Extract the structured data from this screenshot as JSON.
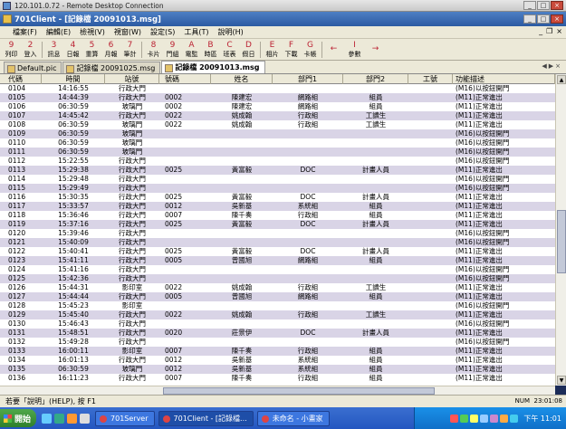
{
  "rd_title": "120.101.0.72 - Remote Desktop Connection",
  "app_title": "701Client - [記錄檔 20091013.msg]",
  "menu": [
    "檔案(F)",
    "編輯(E)",
    "檢視(V)",
    "視窗(W)",
    "設定(S)",
    "工具(T)",
    "說明(H)"
  ],
  "toolbar": [
    {
      "glyph": "9",
      "label": "列印"
    },
    {
      "glyph": "2",
      "label": "登入"
    },
    {
      "glyph": "3",
      "label": "訊息"
    },
    {
      "glyph": "4",
      "label": "日報"
    },
    {
      "glyph": "5",
      "label": "重算"
    },
    {
      "glyph": "6",
      "label": "月報"
    },
    {
      "glyph": "7",
      "label": "筆計"
    },
    {
      "glyph": "8",
      "label": "卡片"
    },
    {
      "glyph": "9",
      "label": "門組"
    },
    {
      "glyph": "A",
      "label": "電監"
    },
    {
      "glyph": "B",
      "label": "時區"
    },
    {
      "glyph": "C",
      "label": "班表"
    },
    {
      "glyph": "D",
      "label": "假日"
    },
    {
      "glyph": "E",
      "label": "相片"
    },
    {
      "glyph": "F",
      "label": "下載"
    },
    {
      "glyph": "G",
      "label": "卡帳"
    },
    {
      "glyph": "←",
      "label": ""
    },
    {
      "glyph": "I",
      "label": "參數"
    },
    {
      "glyph": "→",
      "label": ""
    }
  ],
  "tabs": [
    "Default.pic",
    "記錄檔 20091025.msg",
    "記錄檔 20091013.msg"
  ],
  "columns": [
    "代碼",
    "時間",
    "站號",
    "號碼",
    "姓名",
    "部門1",
    "部門2",
    "工號",
    "功能描述"
  ],
  "rows": [
    [
      "0104",
      "14:16:55",
      "行政大門",
      "",
      "",
      "",
      "",
      "",
      "(M16)以按鈕開門"
    ],
    [
      "0105",
      "14:44:39",
      "行政大門",
      "0002",
      "陳建宏",
      "網路組",
      "組員",
      "",
      "(M11)正常進出"
    ],
    [
      "0106",
      "06:30:59",
      "玻璃門",
      "0002",
      "陳建宏",
      "網路組",
      "組員",
      "",
      "(M11)正常進出"
    ],
    [
      "0107",
      "14:45:42",
      "行政大門",
      "0022",
      "姚成翰",
      "行政組",
      "工讀生",
      "",
      "(M11)正常進出"
    ],
    [
      "0108",
      "06:30:59",
      "玻璃門",
      "0022",
      "姚成翰",
      "行政組",
      "工讀生",
      "",
      "(M11)正常進出"
    ],
    [
      "0109",
      "06:30:59",
      "玻璃門",
      "",
      "",
      "",
      "",
      "",
      "(M16)以按鈕開門"
    ],
    [
      "0110",
      "06:30:59",
      "玻璃門",
      "",
      "",
      "",
      "",
      "",
      "(M16)以按鈕開門"
    ],
    [
      "0111",
      "06:30:59",
      "玻璃門",
      "",
      "",
      "",
      "",
      "",
      "(M16)以按鈕開門"
    ],
    [
      "0112",
      "15:22:55",
      "行政大門",
      "",
      "",
      "",
      "",
      "",
      "(M16)以按鈕開門"
    ],
    [
      "0113",
      "15:29:38",
      "行政大門",
      "0025",
      "黃富毅",
      "DOC",
      "計畫人員",
      "",
      "(M11)正常進出"
    ],
    [
      "0114",
      "15:29:48",
      "行政大門",
      "",
      "",
      "",
      "",
      "",
      "(M16)以按鈕開門"
    ],
    [
      "0115",
      "15:29:49",
      "行政大門",
      "",
      "",
      "",
      "",
      "",
      "(M16)以按鈕開門"
    ],
    [
      "0116",
      "15:30:35",
      "行政大門",
      "0025",
      "黃富毅",
      "DOC",
      "計畫人員",
      "",
      "(M11)正常進出"
    ],
    [
      "0117",
      "15:33:57",
      "行政大門",
      "0012",
      "吳新基",
      "系統組",
      "組員",
      "",
      "(M11)正常進出"
    ],
    [
      "0118",
      "15:36:46",
      "行政大門",
      "0007",
      "陳千奏",
      "行政組",
      "組員",
      "",
      "(M11)正常進出"
    ],
    [
      "0119",
      "15:37:16",
      "行政大門",
      "0025",
      "黃富毅",
      "DOC",
      "計畫人員",
      "",
      "(M11)正常進出"
    ],
    [
      "0120",
      "15:39:46",
      "行政大門",
      "",
      "",
      "",
      "",
      "",
      "(M16)以按鈕開門"
    ],
    [
      "0121",
      "15:40:09",
      "行政大門",
      "",
      "",
      "",
      "",
      "",
      "(M16)以按鈕開門"
    ],
    [
      "0122",
      "15:40:41",
      "行政大門",
      "0025",
      "黃富毅",
      "DOC",
      "計畫人員",
      "",
      "(M11)正常進出"
    ],
    [
      "0123",
      "15:41:11",
      "行政大門",
      "0005",
      "曾國旭",
      "網路組",
      "組員",
      "",
      "(M11)正常進出"
    ],
    [
      "0124",
      "15:41:16",
      "行政大門",
      "",
      "",
      "",
      "",
      "",
      "(M16)以按鈕開門"
    ],
    [
      "0125",
      "15:42:36",
      "行政大門",
      "",
      "",
      "",
      "",
      "",
      "(M16)以按鈕開門"
    ],
    [
      "0126",
      "15:44:31",
      "影印室",
      "0022",
      "姚成翰",
      "行政組",
      "工讀生",
      "",
      "(M11)正常進出"
    ],
    [
      "0127",
      "15:44:44",
      "行政大門",
      "0005",
      "曾國旭",
      "網路組",
      "組員",
      "",
      "(M11)正常進出"
    ],
    [
      "0128",
      "15:45:23",
      "影印室",
      "",
      "",
      "",
      "",
      "",
      "(M16)以按鈕開門"
    ],
    [
      "0129",
      "15:45:40",
      "行政大門",
      "0022",
      "姚成翰",
      "行政組",
      "工讀生",
      "",
      "(M11)正常進出"
    ],
    [
      "0130",
      "15:46:43",
      "行政大門",
      "",
      "",
      "",
      "",
      "",
      "(M16)以按鈕開門"
    ],
    [
      "0131",
      "15:48:51",
      "行政大門",
      "0020",
      "莊景伊",
      "DOC",
      "計畫人員",
      "",
      "(M11)正常進出"
    ],
    [
      "0132",
      "15:49:28",
      "行政大門",
      "",
      "",
      "",
      "",
      "",
      "(M16)以按鈕開門"
    ],
    [
      "0133",
      "16:00:11",
      "影印室",
      "0007",
      "陳千奏",
      "行政組",
      "組員",
      "",
      "(M11)正常進出"
    ],
    [
      "0134",
      "16:01:13",
      "行政大門",
      "0012",
      "吳新基",
      "系統組",
      "組員",
      "",
      "(M11)正常進出"
    ],
    [
      "0135",
      "06:30:59",
      "玻璃門",
      "0012",
      "吳新基",
      "系統組",
      "組員",
      "",
      "(M11)正常進出"
    ],
    [
      "0136",
      "16:11:23",
      "行政大門",
      "0007",
      "陳千奏",
      "行政組",
      "組員",
      "",
      "(M11)正常進出"
    ]
  ],
  "status_text": "若要「說明」(HELP), 按 F1",
  "status_num": "NUM",
  "status_clock": "23:01:08",
  "taskbar": {
    "start": "開始",
    "tasks": [
      "701Server",
      "701Client - [記錄檔...",
      "未命名 - 小畫家"
    ],
    "time": "下午 11:01"
  }
}
